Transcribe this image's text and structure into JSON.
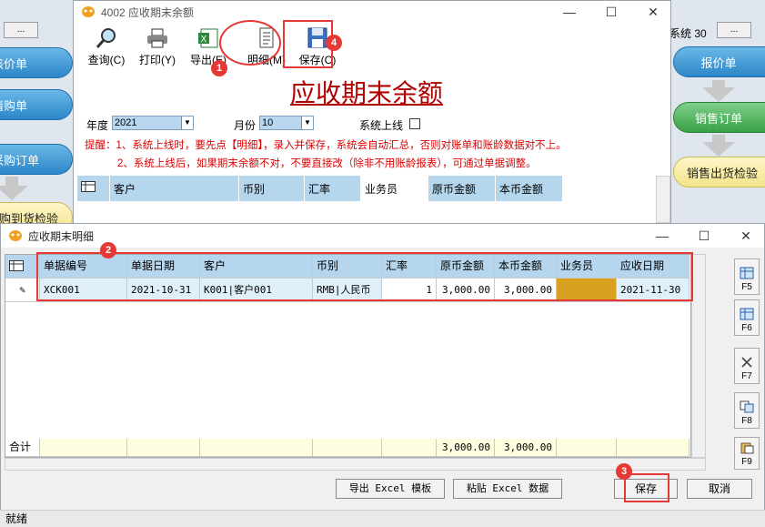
{
  "background_app": {
    "left_buttons": [
      "核价单",
      "请购单",
      "采购订单",
      "购到货检验"
    ],
    "right_buttons": [
      "报价单",
      "销售订单",
      "销售出货检验"
    ],
    "left_small": "...",
    "right_small": "...",
    "right_label": "系统 30"
  },
  "main_window": {
    "title": "4002 应收期末余额",
    "toolbar": [
      {
        "label": "查询(C)",
        "icon": "magnifier-icon"
      },
      {
        "label": "打印(Y)",
        "icon": "printer-icon"
      },
      {
        "label": "导出(E)",
        "icon": "excel-icon"
      },
      {
        "label": "明细(M)",
        "icon": "document-icon"
      },
      {
        "label": "保存(C)",
        "icon": "floppy-icon"
      }
    ],
    "heading": "应收期末余额",
    "year_label": "年度",
    "year_value": "2021",
    "month_label": "月份",
    "month_value": "10",
    "online_label": "系统上线",
    "reminder_line1": "提醒：1、系统上线时，要先点【明细】，录入并保存，系统会自动汇总，否则对账单和账龄数据对不上。",
    "reminder_line2": "2、系统上线后，如果期末余额不对，不要直接改（除非不用账龄报表），可通过单据调整。",
    "columns": [
      "客户",
      "币别",
      "汇率",
      "业务员",
      "原币金额",
      "本币金额"
    ]
  },
  "detail_window": {
    "title": "应收期末明细",
    "columns": [
      "单据编号",
      "单据日期",
      "客户",
      "币别",
      "汇率",
      "原币金额",
      "本币金额",
      "业务员",
      "应收日期"
    ],
    "rows": [
      [
        "XCK001",
        "2021-10-31",
        "K001|客户001",
        "RMB|人民币",
        "1",
        "3,000.00",
        "3,000.00",
        "",
        "2021-11-30"
      ]
    ],
    "footer_label": "合计",
    "footer_original": "3,000.00",
    "footer_local": "3,000.00",
    "side_buttons": [
      "F5",
      "F6",
      "F7",
      "F8",
      "F9"
    ],
    "export_template": "导出 Excel 模板",
    "paste_excel": "粘贴 Excel 数据",
    "save": "保存",
    "cancel": "取消",
    "status": "就绪"
  },
  "annotations": [
    "1",
    "2",
    "3",
    "4"
  ],
  "colors": {
    "accent_red": "#e53935",
    "header_blue": "#b5d6ec",
    "salesperson_cell": "#d9a020"
  }
}
